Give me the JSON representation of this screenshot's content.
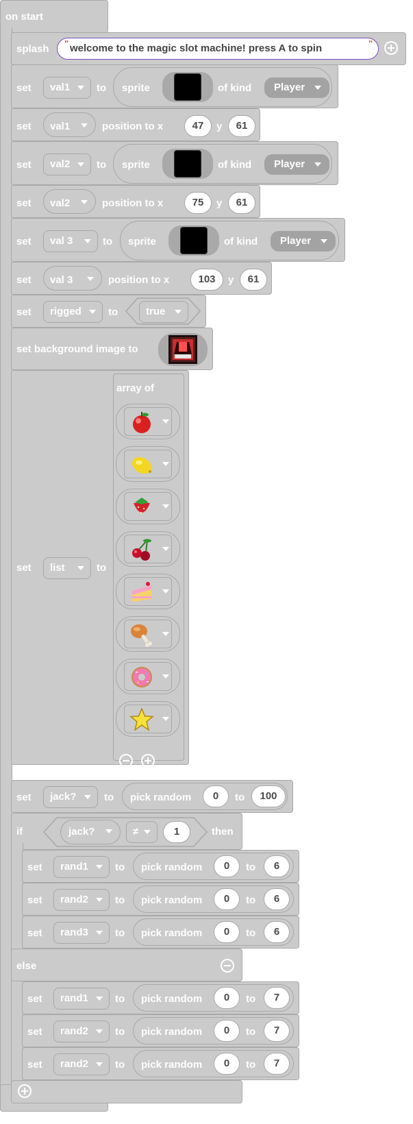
{
  "editor": {
    "on_start": "on start",
    "splash": {
      "label": "splash",
      "text": "welcome to the magic slot machine! press A to spin"
    },
    "kw": {
      "set": "set",
      "to": "to",
      "sprite": "sprite",
      "of_kind": "of kind",
      "position_to_x": "position to x",
      "y": "y",
      "set_bg": "set background image to",
      "array_of": "array of",
      "pick_random": "pick random",
      "if": "if",
      "then": "then",
      "else": "else"
    },
    "sprites": [
      {
        "var": "val1",
        "kind": "Player",
        "x": "47",
        "y": "61"
      },
      {
        "var": "val2",
        "kind": "Player",
        "x": "75",
        "y": "61"
      },
      {
        "var": "val 3",
        "kind": "Player",
        "x": "103",
        "y": "61"
      }
    ],
    "rigged": {
      "var": "rigged",
      "value": "true"
    },
    "list": {
      "var": "list",
      "items": [
        "apple-icon",
        "lemon-icon",
        "strawberry-icon",
        "cherry-icon",
        "cake-icon",
        "drumstick-icon",
        "donut-icon",
        "star-icon"
      ]
    },
    "jack": {
      "var": "jack?",
      "from": "0",
      "to": "100"
    },
    "condition": {
      "var": "jack?",
      "op": "≠",
      "value": "1"
    },
    "then_rows": [
      {
        "var": "rand1",
        "from": "0",
        "to": "6"
      },
      {
        "var": "rand2",
        "from": "0",
        "to": "6"
      },
      {
        "var": "rand3",
        "from": "0",
        "to": "6"
      }
    ],
    "else_rows": [
      {
        "var": "rand1",
        "from": "0",
        "to": "7"
      },
      {
        "var": "rand2",
        "from": "0",
        "to": "7"
      },
      {
        "var": "rand2",
        "from": "0",
        "to": "7"
      }
    ]
  }
}
